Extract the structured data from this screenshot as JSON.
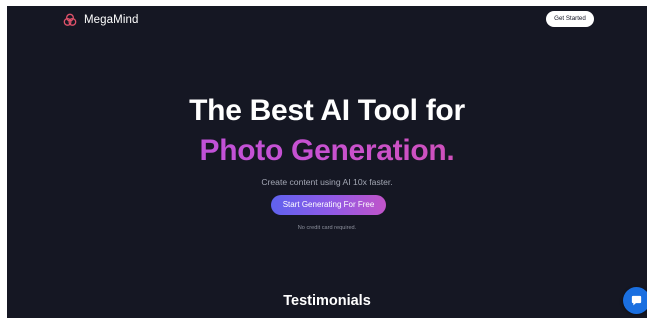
{
  "header": {
    "brand": "MegaMind",
    "logo_icon": "trefoil-logo-icon",
    "get_started_label": "Get Started"
  },
  "hero": {
    "title_line1": "The Best AI Tool for",
    "title_line2": "Photo Generation.",
    "subtitle": "Create content using AI 10x faster.",
    "cta_label": "Start Generating For Free",
    "note": "No credit card required."
  },
  "sections": {
    "testimonials_heading": "Testimonials"
  },
  "widgets": {
    "chat_icon": "chat-bubble-icon"
  },
  "colors": {
    "background": "#151723",
    "accent_gradient_start": "#5f62ee",
    "accent_gradient_end": "#c154c9",
    "title_gradient_start": "#b552e6",
    "title_gradient_end": "#d7509c",
    "chat_button": "#1a6fe0",
    "logo_accent": "#e0526a"
  }
}
